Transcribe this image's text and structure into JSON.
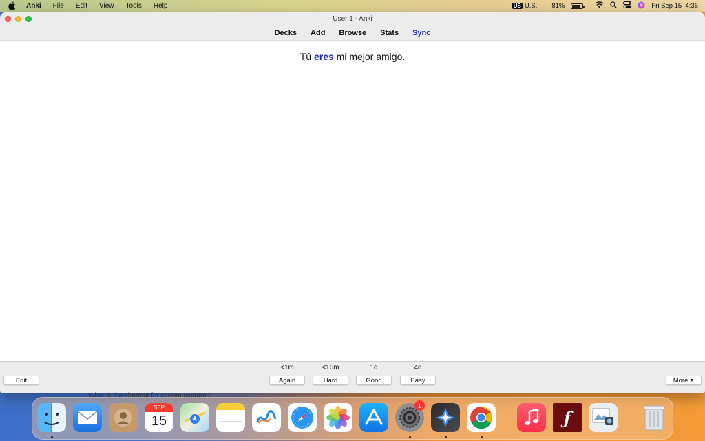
{
  "menubar": {
    "app_name": "Anki",
    "items": [
      "File",
      "Edit",
      "View",
      "Tools",
      "Help"
    ],
    "input_source_badge": "US",
    "input_source_label": "U.S.",
    "battery_percent": "81%",
    "battery_level": 0.81,
    "datetime": "Fri Sep 15  4:36"
  },
  "window": {
    "title": "User 1 - Anki",
    "toolbar": {
      "decks": "Decks",
      "add": "Add",
      "browse": "Browse",
      "stats": "Stats",
      "sync": "Sync"
    },
    "card": {
      "before": "Tú ",
      "highlight": "eres",
      "after": " mi mejor amigo."
    },
    "bottom": {
      "edit": "Edit",
      "more": "More",
      "answers": [
        {
          "interval": "<1m",
          "label": "Again"
        },
        {
          "interval": "<10m",
          "label": "Hard"
        },
        {
          "interval": "1d",
          "label": "Good"
        },
        {
          "interval": "4d",
          "label": "Easy"
        }
      ]
    }
  },
  "background_peek": "What is the shortcut for screen capture?",
  "dock": {
    "calendar_month": "SEP",
    "calendar_day": "15",
    "system_settings_badge": "1",
    "apps": [
      "finder-icon",
      "mail-icon",
      "contacts-icon",
      "calendar-icon",
      "maps-icon",
      "notes-icon",
      "freeform-icon",
      "safari-icon",
      "photos-icon",
      "app-store-icon",
      "system-settings-icon",
      "spark-icon",
      "chrome-icon",
      "music-icon",
      "flash-icon",
      "preview-icon",
      "trash-icon"
    ]
  },
  "colors": {
    "sync_link": "#1c2fa8",
    "highlight": "#1c2fa8"
  }
}
